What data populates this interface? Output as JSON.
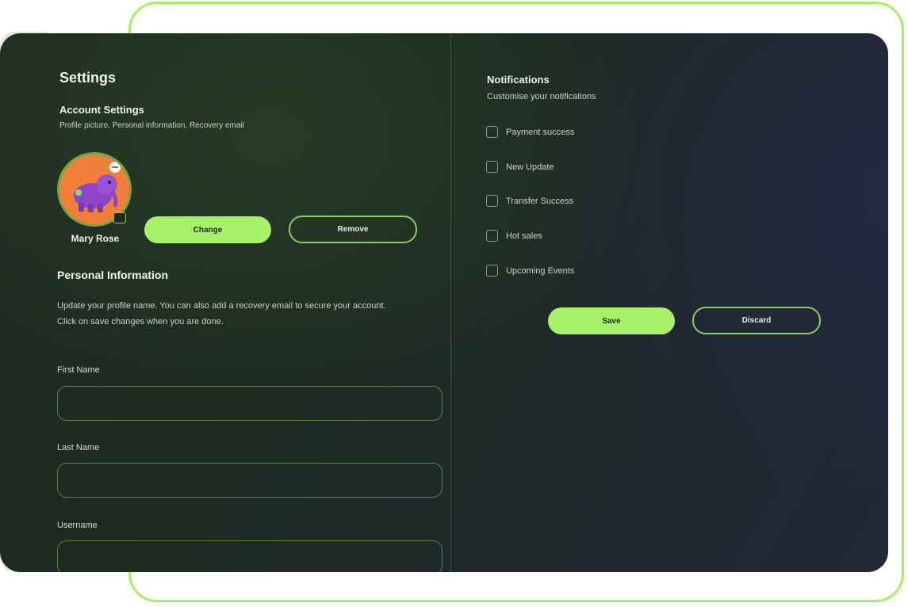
{
  "account": {
    "title": "Settings",
    "section_title": "Account Settings",
    "section_subtitle": "Profile picture, Personal information, Recovery email",
    "user_name": "Mary Rose",
    "change_label": "Change",
    "remove_label": "Remove"
  },
  "personal": {
    "title": "Personal Information",
    "description": "Update your profile name. You can also add a recovery email to secure your account.",
    "note": "Click on save changes when you are done.",
    "fields": [
      {
        "label": "First Name",
        "value": ""
      },
      {
        "label": "Last Name",
        "value": ""
      },
      {
        "label": "Username",
        "value": ""
      }
    ]
  },
  "notifications": {
    "title": "Notifications",
    "subtitle": "Customise your notifications",
    "options": [
      {
        "label": "Payment success",
        "checked": false
      },
      {
        "label": "New Update",
        "checked": false
      },
      {
        "label": "Transfer Success",
        "checked": false
      },
      {
        "label": "Hot sales",
        "checked": false
      },
      {
        "label": "Upcoming Events",
        "checked": false
      }
    ],
    "save_label": "Save",
    "discard_label": "Discard"
  },
  "colors": {
    "accent": "#a8f16a",
    "frame": "#a6f062",
    "avatar_bg": "#f07f3a",
    "panel_dark": "#1f2c22"
  }
}
